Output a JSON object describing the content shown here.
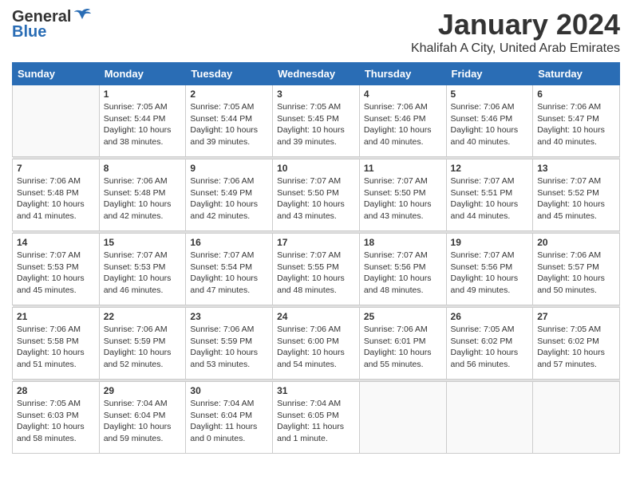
{
  "logo": {
    "general": "General",
    "blue": "Blue"
  },
  "title": "January 2024",
  "location": "Khalifah A City, United Arab Emirates",
  "days_header": [
    "Sunday",
    "Monday",
    "Tuesday",
    "Wednesday",
    "Thursday",
    "Friday",
    "Saturday"
  ],
  "weeks": [
    [
      {
        "day": "",
        "info": ""
      },
      {
        "day": "1",
        "info": "Sunrise: 7:05 AM\nSunset: 5:44 PM\nDaylight: 10 hours\nand 38 minutes."
      },
      {
        "day": "2",
        "info": "Sunrise: 7:05 AM\nSunset: 5:44 PM\nDaylight: 10 hours\nand 39 minutes."
      },
      {
        "day": "3",
        "info": "Sunrise: 7:05 AM\nSunset: 5:45 PM\nDaylight: 10 hours\nand 39 minutes."
      },
      {
        "day": "4",
        "info": "Sunrise: 7:06 AM\nSunset: 5:46 PM\nDaylight: 10 hours\nand 40 minutes."
      },
      {
        "day": "5",
        "info": "Sunrise: 7:06 AM\nSunset: 5:46 PM\nDaylight: 10 hours\nand 40 minutes."
      },
      {
        "day": "6",
        "info": "Sunrise: 7:06 AM\nSunset: 5:47 PM\nDaylight: 10 hours\nand 40 minutes."
      }
    ],
    [
      {
        "day": "7",
        "info": "Sunrise: 7:06 AM\nSunset: 5:48 PM\nDaylight: 10 hours\nand 41 minutes."
      },
      {
        "day": "8",
        "info": "Sunrise: 7:06 AM\nSunset: 5:48 PM\nDaylight: 10 hours\nand 42 minutes."
      },
      {
        "day": "9",
        "info": "Sunrise: 7:06 AM\nSunset: 5:49 PM\nDaylight: 10 hours\nand 42 minutes."
      },
      {
        "day": "10",
        "info": "Sunrise: 7:07 AM\nSunset: 5:50 PM\nDaylight: 10 hours\nand 43 minutes."
      },
      {
        "day": "11",
        "info": "Sunrise: 7:07 AM\nSunset: 5:50 PM\nDaylight: 10 hours\nand 43 minutes."
      },
      {
        "day": "12",
        "info": "Sunrise: 7:07 AM\nSunset: 5:51 PM\nDaylight: 10 hours\nand 44 minutes."
      },
      {
        "day": "13",
        "info": "Sunrise: 7:07 AM\nSunset: 5:52 PM\nDaylight: 10 hours\nand 45 minutes."
      }
    ],
    [
      {
        "day": "14",
        "info": "Sunrise: 7:07 AM\nSunset: 5:53 PM\nDaylight: 10 hours\nand 45 minutes."
      },
      {
        "day": "15",
        "info": "Sunrise: 7:07 AM\nSunset: 5:53 PM\nDaylight: 10 hours\nand 46 minutes."
      },
      {
        "day": "16",
        "info": "Sunrise: 7:07 AM\nSunset: 5:54 PM\nDaylight: 10 hours\nand 47 minutes."
      },
      {
        "day": "17",
        "info": "Sunrise: 7:07 AM\nSunset: 5:55 PM\nDaylight: 10 hours\nand 48 minutes."
      },
      {
        "day": "18",
        "info": "Sunrise: 7:07 AM\nSunset: 5:56 PM\nDaylight: 10 hours\nand 48 minutes."
      },
      {
        "day": "19",
        "info": "Sunrise: 7:07 AM\nSunset: 5:56 PM\nDaylight: 10 hours\nand 49 minutes."
      },
      {
        "day": "20",
        "info": "Sunrise: 7:06 AM\nSunset: 5:57 PM\nDaylight: 10 hours\nand 50 minutes."
      }
    ],
    [
      {
        "day": "21",
        "info": "Sunrise: 7:06 AM\nSunset: 5:58 PM\nDaylight: 10 hours\nand 51 minutes."
      },
      {
        "day": "22",
        "info": "Sunrise: 7:06 AM\nSunset: 5:59 PM\nDaylight: 10 hours\nand 52 minutes."
      },
      {
        "day": "23",
        "info": "Sunrise: 7:06 AM\nSunset: 5:59 PM\nDaylight: 10 hours\nand 53 minutes."
      },
      {
        "day": "24",
        "info": "Sunrise: 7:06 AM\nSunset: 6:00 PM\nDaylight: 10 hours\nand 54 minutes."
      },
      {
        "day": "25",
        "info": "Sunrise: 7:06 AM\nSunset: 6:01 PM\nDaylight: 10 hours\nand 55 minutes."
      },
      {
        "day": "26",
        "info": "Sunrise: 7:05 AM\nSunset: 6:02 PM\nDaylight: 10 hours\nand 56 minutes."
      },
      {
        "day": "27",
        "info": "Sunrise: 7:05 AM\nSunset: 6:02 PM\nDaylight: 10 hours\nand 57 minutes."
      }
    ],
    [
      {
        "day": "28",
        "info": "Sunrise: 7:05 AM\nSunset: 6:03 PM\nDaylight: 10 hours\nand 58 minutes."
      },
      {
        "day": "29",
        "info": "Sunrise: 7:04 AM\nSunset: 6:04 PM\nDaylight: 10 hours\nand 59 minutes."
      },
      {
        "day": "30",
        "info": "Sunrise: 7:04 AM\nSunset: 6:04 PM\nDaylight: 11 hours\nand 0 minutes."
      },
      {
        "day": "31",
        "info": "Sunrise: 7:04 AM\nSunset: 6:05 PM\nDaylight: 11 hours\nand 1 minute."
      },
      {
        "day": "",
        "info": ""
      },
      {
        "day": "",
        "info": ""
      },
      {
        "day": "",
        "info": ""
      }
    ]
  ]
}
